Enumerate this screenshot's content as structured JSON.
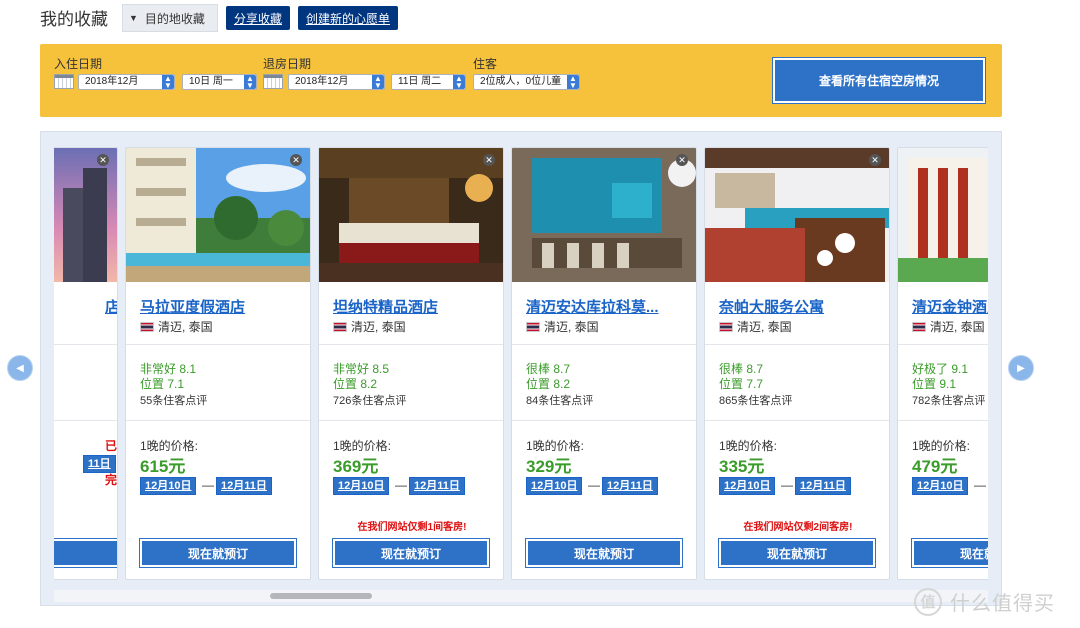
{
  "header": {
    "title": "我的收藏",
    "dropdown_label": "目的地收藏",
    "share_label": "分享收藏",
    "create_label": "创建新的心愿单"
  },
  "search": {
    "checkin_label": "入住日期",
    "checkin_month": "2018年12月",
    "checkin_day": "10日 周一",
    "checkout_label": "退房日期",
    "checkout_month": "2018年12月",
    "checkout_day": "11日 周二",
    "guests_label": "住客",
    "guests_value": "2位成人，0位儿童",
    "search_button": "查看所有住宿空房情况"
  },
  "partial_left_card": {
    "name_fragment": "店",
    "sold_out": "已售完",
    "date_fragment": "11日"
  },
  "cards": [
    {
      "name": "马拉亚度假酒店",
      "location": "清迈, 泰国",
      "score_text": "非常好 8.1",
      "location_score": "位置 7.1",
      "reviews": "55条住客点评",
      "price_label": "1晚的价格:",
      "price": "615元",
      "checkin_tag": "12月10日",
      "checkout_tag": "12月11日",
      "scarcity": "",
      "book": "现在就预订"
    },
    {
      "name": "坦纳特精品酒店",
      "location": "清迈, 泰国",
      "score_text": "非常好 8.5",
      "location_score": "位置 8.2",
      "reviews": "726条住客点评",
      "price_label": "1晚的价格:",
      "price": "369元",
      "checkin_tag": "12月10日",
      "checkout_tag": "12月11日",
      "scarcity": "在我们网站仅剩1间客房!",
      "book": "现在就预订"
    },
    {
      "name": "清迈安达库拉科莫...",
      "location": "清迈, 泰国",
      "score_text": "很棒 8.7",
      "location_score": "位置 8.2",
      "reviews": "84条住客点评",
      "price_label": "1晚的价格:",
      "price": "329元",
      "checkin_tag": "12月10日",
      "checkout_tag": "12月11日",
      "scarcity": "",
      "book": "现在就预订"
    },
    {
      "name": "奈帕大服务公寓",
      "location": "清迈, 泰国",
      "score_text": "很棒 8.7",
      "location_score": "位置 7.7",
      "reviews": "865条住客点评",
      "price_label": "1晚的价格:",
      "price": "335元",
      "checkin_tag": "12月10日",
      "checkout_tag": "12月11日",
      "scarcity": "在我们网站仅剩2间客房!",
      "book": "现在就预订"
    },
    {
      "name": "清迈金钟酒店",
      "location": "清迈, 泰国",
      "score_text": "好极了 9.1",
      "location_score": "位置 9.1",
      "reviews": "782条住客点评",
      "price_label": "1晚的价格:",
      "price": "479元",
      "checkin_tag": "12月10日",
      "checkout_tag": "",
      "scarcity": "",
      "book": "现在就预订"
    }
  ],
  "watermark": {
    "text": "什么值得买",
    "logo_glyph": "值"
  },
  "colors": {
    "brand_navy": "#003580",
    "accent_blue": "#2e72c8",
    "search_band": "#f6c23b",
    "score_green": "#3a9c2a",
    "alert_red": "#dd1111"
  }
}
